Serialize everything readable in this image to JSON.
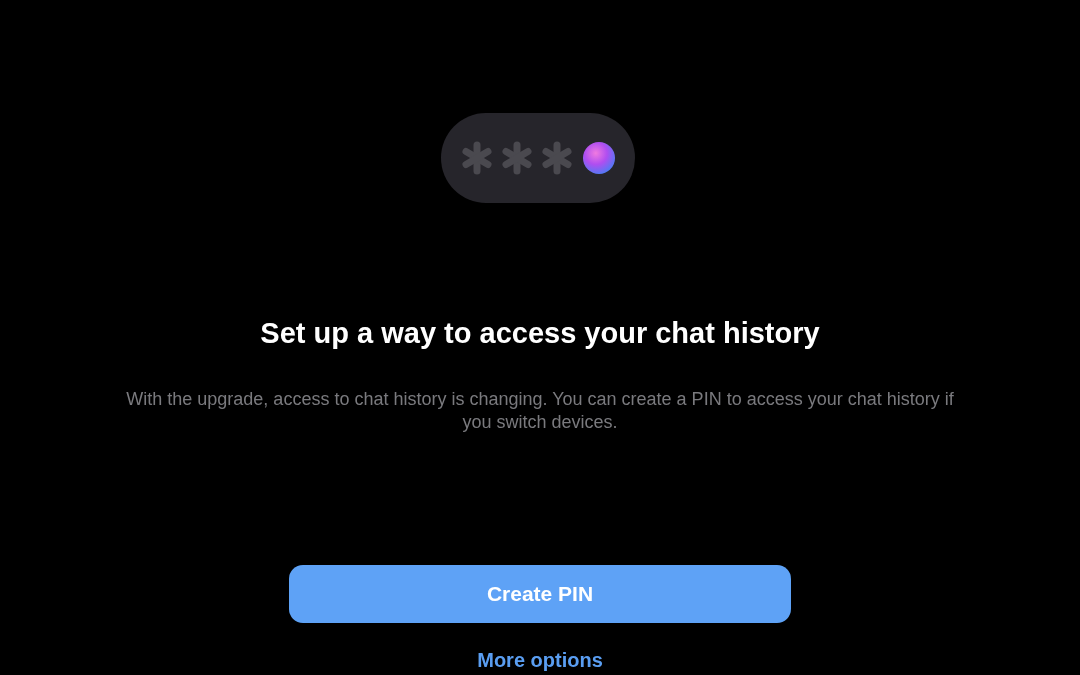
{
  "title": "Set up a way to access your chat history",
  "description": "With the upgrade, access to chat history is changing. You can create a PIN to access your chat history if you switch devices.",
  "primary_button": {
    "label": "Create PIN"
  },
  "secondary_link": {
    "label": "More options"
  }
}
